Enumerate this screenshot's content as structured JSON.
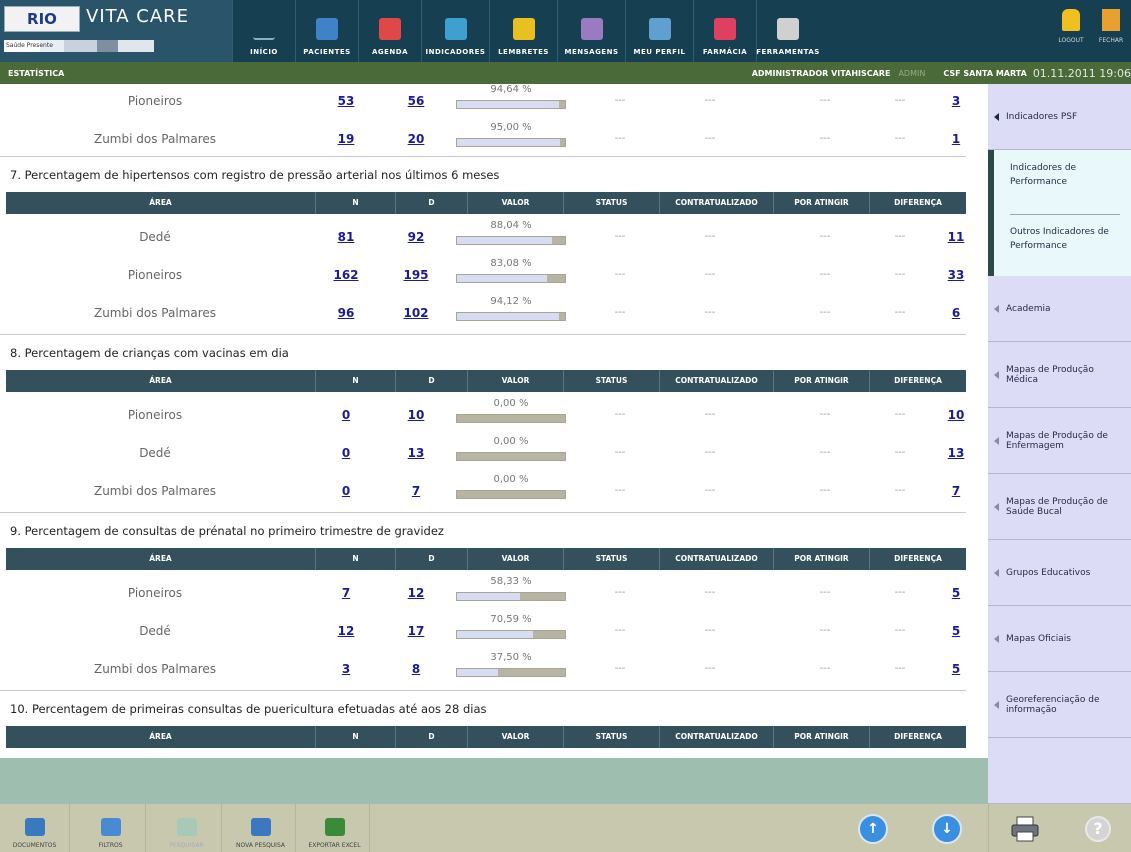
{
  "header": {
    "logo_rio": "RIO",
    "logo_vitacare": "VITA CARE",
    "logo_strip": "Saúde Presente",
    "nav": [
      {
        "label": "Início",
        "icon": "heartbeat-icon"
      },
      {
        "label": "Pacientes",
        "icon": "patient-icon"
      },
      {
        "label": "Agenda",
        "icon": "agenda-icon"
      },
      {
        "label": "Indicadores",
        "icon": "chart-icon"
      },
      {
        "label": "Lembretes",
        "icon": "reminder-icon"
      },
      {
        "label": "Mensagens",
        "icon": "envelope-icon"
      },
      {
        "label": "Meu Perfil",
        "icon": "profile-card-icon"
      },
      {
        "label": "Farmácia",
        "icon": "pill-icon"
      },
      {
        "label": "Ferramentas",
        "icon": "tools-icon"
      }
    ],
    "logout_label": "Logout",
    "close_label": "Fechar"
  },
  "status": {
    "section": "ESTATÍSTICA",
    "user": "ADMINISTRADOR VITAHISCARE",
    "role": "ADMIN",
    "clinic": "CSF SANTA MARTA",
    "datetime": "01.11.2011 19:06"
  },
  "table_headers": [
    "Área",
    "N",
    "D",
    "Valor",
    "Status",
    "Contratualizado",
    "Por atingir",
    "Diferença"
  ],
  "partial_rows": [
    {
      "area": "Pioneiros",
      "n": "53",
      "d": "56",
      "valor": "94,64 %",
      "fraction": 0.9464,
      "status": "---",
      "contratualizado": "---",
      "por_atingir": "---",
      "extra": "---",
      "diferenca": "3"
    },
    {
      "area": "Zumbi dos Palmares",
      "n": "19",
      "d": "20",
      "valor": "95,00 %",
      "fraction": 0.95,
      "status": "---",
      "contratualizado": "---",
      "por_atingir": "---",
      "extra": "---",
      "diferenca": "1"
    }
  ],
  "sections": [
    {
      "title": "7. Percentagem de hipertensos com registro de pressão arterial nos últimos 6 meses",
      "rows": [
        {
          "area": "Dedé",
          "n": "81",
          "d": "92",
          "valor": "88,04 %",
          "fraction": 0.8804,
          "status": "---",
          "contratualizado": "---",
          "por_atingir": "---",
          "extra": "---",
          "diferenca": "11"
        },
        {
          "area": "Pioneiros",
          "n": "162",
          "d": "195",
          "valor": "83,08 %",
          "fraction": 0.8308,
          "status": "---",
          "contratualizado": "---",
          "por_atingir": "---",
          "extra": "---",
          "diferenca": "33"
        },
        {
          "area": "Zumbi dos Palmares",
          "n": "96",
          "d": "102",
          "valor": "94,12 %",
          "fraction": 0.9412,
          "status": "---",
          "contratualizado": "---",
          "por_atingir": "---",
          "extra": "---",
          "diferenca": "6"
        }
      ]
    },
    {
      "title": "8. Percentagem de crianças com vacinas em dia",
      "rows": [
        {
          "area": "Pioneiros",
          "n": "0",
          "d": "10",
          "valor": "0,00 %",
          "fraction": 0,
          "status": "---",
          "contratualizado": "---",
          "por_atingir": "---",
          "extra": "---",
          "diferenca": "10"
        },
        {
          "area": "Dedé",
          "n": "0",
          "d": "13",
          "valor": "0,00 %",
          "fraction": 0,
          "status": "---",
          "contratualizado": "---",
          "por_atingir": "---",
          "extra": "---",
          "diferenca": "13"
        },
        {
          "area": "Zumbi dos Palmares",
          "n": "0",
          "d": "7",
          "valor": "0,00 %",
          "fraction": 0,
          "status": "---",
          "contratualizado": "---",
          "por_atingir": "---",
          "extra": "---",
          "diferenca": "7"
        }
      ]
    },
    {
      "title": "9. Percentagem de consultas de prénatal no primeiro trimestre de gravidez",
      "rows": [
        {
          "area": "Pioneiros",
          "n": "7",
          "d": "12",
          "valor": "58,33 %",
          "fraction": 0.5833,
          "status": "---",
          "contratualizado": "---",
          "por_atingir": "---",
          "extra": "---",
          "diferenca": "5"
        },
        {
          "area": "Dedé",
          "n": "12",
          "d": "17",
          "valor": "70,59 %",
          "fraction": 0.7059,
          "status": "---",
          "contratualizado": "---",
          "por_atingir": "---",
          "extra": "---",
          "diferenca": "5"
        },
        {
          "area": "Zumbi dos Palmares",
          "n": "3",
          "d": "8",
          "valor": "37,50 %",
          "fraction": 0.375,
          "status": "---",
          "contratualizado": "---",
          "por_atingir": "---",
          "extra": "---",
          "diferenca": "5"
        }
      ]
    },
    {
      "title": "10. Percentagem de primeiras consultas de puericultura efetuadas até aos 28 dias",
      "rows": []
    }
  ],
  "sidebar": {
    "top_item": "Indicadores PSF",
    "sub_items": [
      "Indicadores de Performance",
      "Outros Indicadores de Performance"
    ],
    "items": [
      "Academia",
      "Mapas de Produção Médica",
      "Mapas de Produção de Enfermagem",
      "Mapas de Produção de Saúde Bucal",
      "Grupos Educativos",
      "Mapas Oficiais",
      "Georeferenciação de informação"
    ]
  },
  "toolbar": {
    "buttons": [
      {
        "label": "Documentos",
        "icon": "documents-icon"
      },
      {
        "label": "Filtros",
        "icon": "filter-icon"
      },
      {
        "label": "Pesquisar",
        "icon": "search-icon",
        "disabled": true
      },
      {
        "label": "Nova Pesquisa",
        "icon": "new-search-icon"
      },
      {
        "label": "Exportar Excel",
        "icon": "excel-icon"
      }
    ],
    "scroll_up": "↑",
    "scroll_down": "↓",
    "help": "?"
  },
  "colors": {
    "topbar": "#173f52",
    "statusbar": "#4a6a3a",
    "table_header": "#34505c",
    "sidebar": "#dcdcf6",
    "link": "#1a1a9a"
  }
}
